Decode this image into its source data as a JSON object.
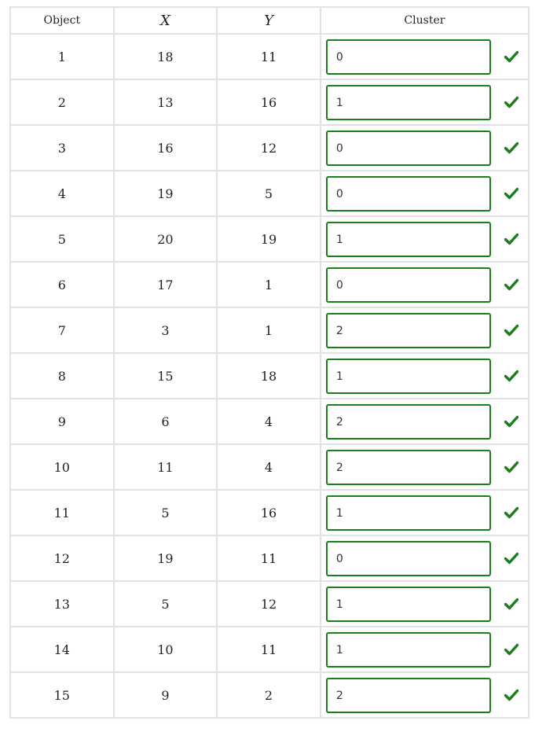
{
  "table": {
    "headers": {
      "object": "Object",
      "x": "X",
      "y": "Y",
      "cluster": "Cluster"
    },
    "rows": [
      {
        "object": "1",
        "x": "18",
        "y": "11",
        "cluster": "0"
      },
      {
        "object": "2",
        "x": "13",
        "y": "16",
        "cluster": "1"
      },
      {
        "object": "3",
        "x": "16",
        "y": "12",
        "cluster": "0"
      },
      {
        "object": "4",
        "x": "19",
        "y": "5",
        "cluster": "0"
      },
      {
        "object": "5",
        "x": "20",
        "y": "19",
        "cluster": "1"
      },
      {
        "object": "6",
        "x": "17",
        "y": "1",
        "cluster": "0"
      },
      {
        "object": "7",
        "x": "3",
        "y": "1",
        "cluster": "2"
      },
      {
        "object": "8",
        "x": "15",
        "y": "18",
        "cluster": "1"
      },
      {
        "object": "9",
        "x": "6",
        "y": "4",
        "cluster": "2"
      },
      {
        "object": "10",
        "x": "11",
        "y": "4",
        "cluster": "2"
      },
      {
        "object": "11",
        "x": "5",
        "y": "16",
        "cluster": "1"
      },
      {
        "object": "12",
        "x": "19",
        "y": "11",
        "cluster": "0"
      },
      {
        "object": "13",
        "x": "5",
        "y": "12",
        "cluster": "1"
      },
      {
        "object": "14",
        "x": "10",
        "y": "11",
        "cluster": "1"
      },
      {
        "object": "15",
        "x": "9",
        "y": "2",
        "cluster": "2"
      }
    ]
  },
  "status": {
    "correct_icon": "checkmark-icon",
    "correct_color": "#1a7f1a"
  },
  "colors": {
    "input_border": "#1a7f1a",
    "grid_line": "#e2e2e2"
  }
}
